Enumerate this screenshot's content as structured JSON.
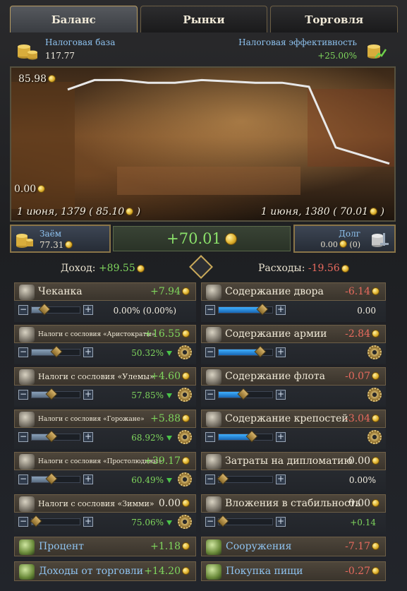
{
  "tabs": [
    {
      "label": "Баланс",
      "active": true
    },
    {
      "label": "Рынки",
      "active": false
    },
    {
      "label": "Торговля",
      "active": false
    }
  ],
  "header": {
    "tax_base_label": "Налоговая база",
    "tax_base_value": "117.77",
    "tax_eff_label": "Налоговая эффективность",
    "tax_eff_value": "+25.00%"
  },
  "chart_data": {
    "type": "line",
    "y_max_label": "85.98",
    "y_min_label": "0.00",
    "ylim": [
      0,
      85.98
    ],
    "x_start_label": "1 июня, 1379 ( 85.10",
    "x_end_label": "1 июня, 1380 ( 70.01",
    "values": [
      73,
      80,
      80,
      78,
      78,
      80,
      79,
      78,
      78,
      75,
      30,
      24,
      18
    ],
    "line_color": "#e8e8e8"
  },
  "summary": {
    "loan_label": "Заём",
    "loan_value": "77.31",
    "net_value": "+70.01",
    "debt_label": "Долг",
    "debt_value": "0.00",
    "debt_count": "(0)"
  },
  "income_label": "Доход:",
  "income_value": "+89.55",
  "expense_label": "Расходы:",
  "expense_value": "-19.56",
  "income_rows": [
    {
      "name": "Чеканка",
      "value": "+7.94",
      "pct": "0.00% (0.00%)",
      "level": 0.25,
      "size": "big"
    },
    {
      "name": "Налоги с сословия «Аристократы»",
      "value": "+16.55",
      "pct": "50.32%",
      "level": 0.5,
      "size": "small"
    },
    {
      "name": "Налоги с сословия «Улемы»",
      "value": "+4.60",
      "pct": "57.85%",
      "level": 0.4,
      "size": "med"
    },
    {
      "name": "Налоги с сословия «Горожане»",
      "value": "+5.88",
      "pct": "68.92%",
      "level": 0.4,
      "size": "small"
    },
    {
      "name": "Налоги с сословия «Простолюдины»",
      "value": "+39.17",
      "pct": "60.49%",
      "level": 0.4,
      "size": "small"
    },
    {
      "name": "Налоги с сословия «Зимми»",
      "value": "0.00",
      "pct": "75.06%",
      "level": 0.05,
      "size": "med"
    }
  ],
  "expense_rows": [
    {
      "name": "Содержание двора",
      "value": "-6.14",
      "pct": "0.00",
      "level": 0.8
    },
    {
      "name": "Содержание армии",
      "value": "-2.84",
      "pct": "",
      "level": 0.75
    },
    {
      "name": "Содержание флота",
      "value": "-0.07",
      "pct": "",
      "level": 0.45
    },
    {
      "name": "Содержание крепостей",
      "value": "-3.04",
      "pct": "",
      "level": 0.6
    },
    {
      "name": "Затраты на дипломатию",
      "value": "0.00",
      "pct": "0.00%",
      "level": 0.0
    },
    {
      "name": "Вложения в стабильность",
      "value": "0.00",
      "pct": "+0.14",
      "level": 0.0
    }
  ],
  "bottom_left": [
    {
      "name": "Процент",
      "value": "+1.18"
    },
    {
      "name": "Доходы от торговли",
      "value": "+14.20"
    }
  ],
  "bottom_right": [
    {
      "name": "Сооружения",
      "value": "-7.17"
    },
    {
      "name": "Покупка пищи",
      "value": "-0.27"
    }
  ],
  "colors": {
    "positive": "#7fd65d",
    "negative": "#e86a5e",
    "label_blue": "#8fc3f0",
    "slider_blue": "#1e8ee8"
  }
}
